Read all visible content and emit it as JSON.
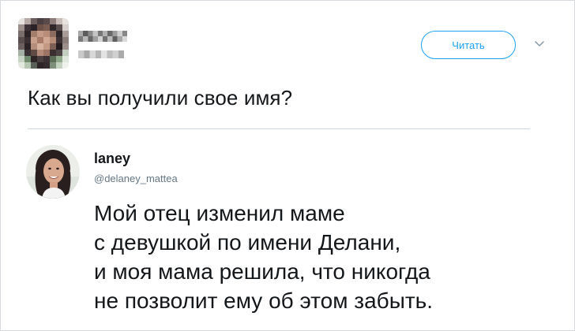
{
  "header": {
    "follow_label": "Читать",
    "caret_icon": "chevron-down-icon",
    "accent_color": "#1da1f2"
  },
  "tweet": {
    "text": "Как вы получили свое имя?"
  },
  "reply": {
    "name": "laney",
    "handle": "@delaney_mattea",
    "lines": [
      "Мой отец изменил маме",
      "с девушкой по имени Делани,",
      "и моя мама решила, что никогда",
      "не позволит ему об этом забыть."
    ]
  }
}
